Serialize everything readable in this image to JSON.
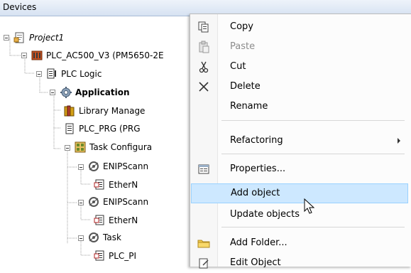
{
  "panel": {
    "title": "Devices"
  },
  "tree": {
    "items": [
      {
        "label": "Project1",
        "icon": "project-icon"
      },
      {
        "label": "PLC_AC500_V3 (PM5650-2E",
        "icon": "plc-device-icon"
      },
      {
        "label": "PLC Logic",
        "icon": "plc-logic-icon"
      },
      {
        "label": "Application",
        "icon": "application-gear-icon"
      },
      {
        "label": "Library Manage",
        "icon": "library-manager-icon"
      },
      {
        "label": "PLC_PRG (PRG",
        "icon": "program-icon"
      },
      {
        "label": "Task Configura",
        "icon": "task-configuration-icon"
      },
      {
        "label": "ENIPScann",
        "icon": "task-icon"
      },
      {
        "label": "EtherN",
        "icon": "pou-call-icon"
      },
      {
        "label": "ENIPScann",
        "icon": "task-icon"
      },
      {
        "label": "EtherN",
        "icon": "pou-call-icon"
      },
      {
        "label": "Task",
        "icon": "task-icon"
      },
      {
        "label": "PLC_PI",
        "icon": "pou-call-icon"
      }
    ]
  },
  "context_menu": {
    "items": [
      {
        "label": "Copy",
        "icon": "copy-icon"
      },
      {
        "label": "Paste",
        "icon": "paste-icon",
        "disabled": true
      },
      {
        "label": "Cut",
        "icon": "cut-icon"
      },
      {
        "label": "Delete",
        "icon": "delete-icon"
      },
      {
        "label": "Rename",
        "icon": ""
      },
      {
        "label": "Refactoring",
        "icon": "",
        "submenu": true
      },
      {
        "label": "Properties...",
        "icon": "properties-icon"
      },
      {
        "label": "Add object",
        "icon": "",
        "hovered": true
      },
      {
        "label": "Update objects",
        "icon": ""
      },
      {
        "label": "Add Folder...",
        "icon": "folder-icon"
      },
      {
        "label": "Edit Object",
        "icon": "edit-object-icon"
      }
    ]
  },
  "colors": {
    "hover_bg": "#cde8ff",
    "hover_border": "#99d1ff",
    "disabled_text": "#8c8c8c"
  }
}
